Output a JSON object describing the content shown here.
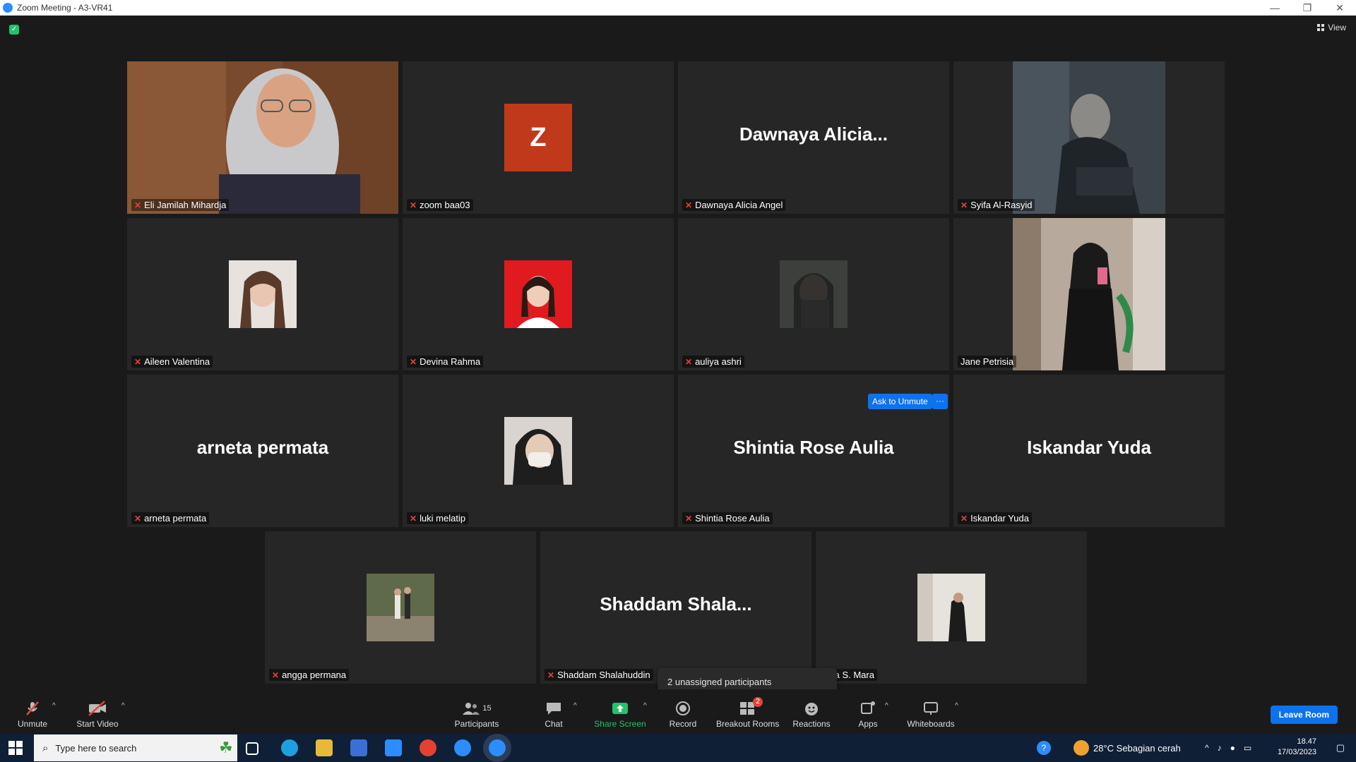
{
  "window": {
    "title": "Zoom Meeting - A3-VR41",
    "controls": [
      "—",
      "❐",
      "✕"
    ]
  },
  "view_label": "View",
  "tiles": [
    {
      "name": "Eli Jamilah Mihardja",
      "muted": true,
      "active": true,
      "kind": "video"
    },
    {
      "name": "zoom baa03",
      "muted": true,
      "kind": "letter",
      "letter": "Z",
      "color": "#c0391b"
    },
    {
      "name": "Dawnaya Alicia Angel",
      "muted": true,
      "kind": "text",
      "big": "Dawnaya  Alicia..."
    },
    {
      "name": "Syifa Al-Rasyid",
      "muted": true,
      "kind": "photo-tall"
    },
    {
      "name": "Aileen Valentina",
      "muted": true,
      "kind": "avatar"
    },
    {
      "name": "Devina Rahma",
      "muted": true,
      "kind": "avatar-red"
    },
    {
      "name": "auliya ashri",
      "muted": true,
      "kind": "avatar"
    },
    {
      "name": "Jane Petrisia",
      "muted": false,
      "kind": "photo-tall"
    },
    {
      "name": "arneta permata",
      "muted": true,
      "kind": "text",
      "big": "arneta permata"
    },
    {
      "name": "luki melatip",
      "muted": true,
      "kind": "avatar"
    },
    {
      "name": "Shintia Rose Aulia",
      "muted": true,
      "kind": "text",
      "big": "Shintia Rose Aulia"
    },
    {
      "name": "Iskandar Yuda",
      "muted": true,
      "kind": "text",
      "big": "Iskandar Yuda"
    },
    {
      "name": "angga permana",
      "muted": true,
      "kind": "avatar"
    },
    {
      "name": "Shaddam Shalahuddin",
      "muted": true,
      "kind": "text",
      "big": "Shaddam  Shala..."
    },
    {
      "name": "tista S. Mara",
      "muted": false,
      "kind": "avatar"
    }
  ],
  "ask_unmute": "Ask to Unmute",
  "ask_more": "···",
  "tooltip": "2 unassigned participants",
  "toolbar": {
    "unmute": "Unmute",
    "start_video": "Start Video",
    "participants": "Participants",
    "participants_count": "15",
    "chat": "Chat",
    "share_screen": "Share Screen",
    "record": "Record",
    "breakout_rooms": "Breakout Rooms",
    "breakout_badge": "2",
    "reactions": "Reactions",
    "apps": "Apps",
    "whiteboards": "Whiteboards",
    "leave": "Leave Room"
  },
  "taskbar": {
    "search_placeholder": "Type here to search",
    "weather": "28°C  Sebagian cerah",
    "time": "18.47",
    "date": "17/03/2023"
  },
  "colors": {
    "accent": "#0e72ed",
    "active_border": "#d8e64a",
    "mute_red": "#e0453a",
    "share_green": "#23c26b"
  }
}
